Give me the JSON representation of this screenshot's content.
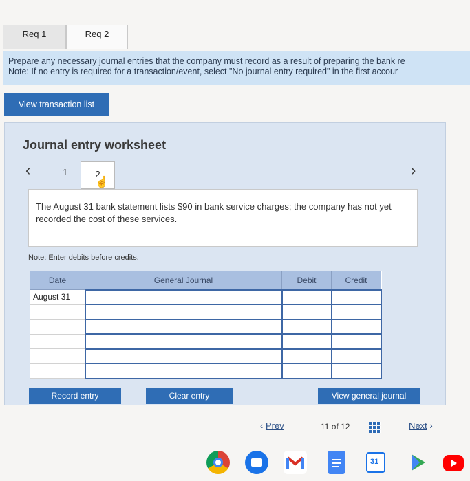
{
  "tabs": [
    {
      "label": "Req 1"
    },
    {
      "label": "Req 2"
    }
  ],
  "instructions": {
    "line1": "Prepare any necessary journal entries that the company must record as a result of preparing the bank re",
    "line2": "Note: If no entry is required for a transaction/event, select \"No journal entry required\" in the first accour"
  },
  "view_transactions_label": "View transaction list",
  "worksheet": {
    "title": "Journal entry worksheet",
    "steps": [
      "1",
      "2"
    ],
    "description": "The August 31 bank statement lists $90 in bank service charges; the company has not yet recorded the cost of these services.",
    "note": "Note: Enter debits before credits."
  },
  "journal_table": {
    "headers": [
      "Date",
      "General Journal",
      "Debit",
      "Credit"
    ],
    "rows": [
      {
        "date": "August 31",
        "account": "",
        "debit": "",
        "credit": ""
      },
      {
        "date": "",
        "account": "",
        "debit": "",
        "credit": ""
      },
      {
        "date": "",
        "account": "",
        "debit": "",
        "credit": ""
      },
      {
        "date": "",
        "account": "",
        "debit": "",
        "credit": ""
      },
      {
        "date": "",
        "account": "",
        "debit": "",
        "credit": ""
      },
      {
        "date": "",
        "account": "",
        "debit": "",
        "credit": ""
      }
    ]
  },
  "buttons": {
    "record": "Record entry",
    "clear": "Clear entry",
    "view_general": "View general journal"
  },
  "pager": {
    "prev": "Prev",
    "count": "11 of 12",
    "next": "Next"
  },
  "dock_icons": [
    "chrome-icon",
    "files-icon",
    "gmail-icon",
    "docs-icon",
    "calendar-icon",
    "play-store-icon",
    "youtube-icon"
  ],
  "calendar_day": "31"
}
